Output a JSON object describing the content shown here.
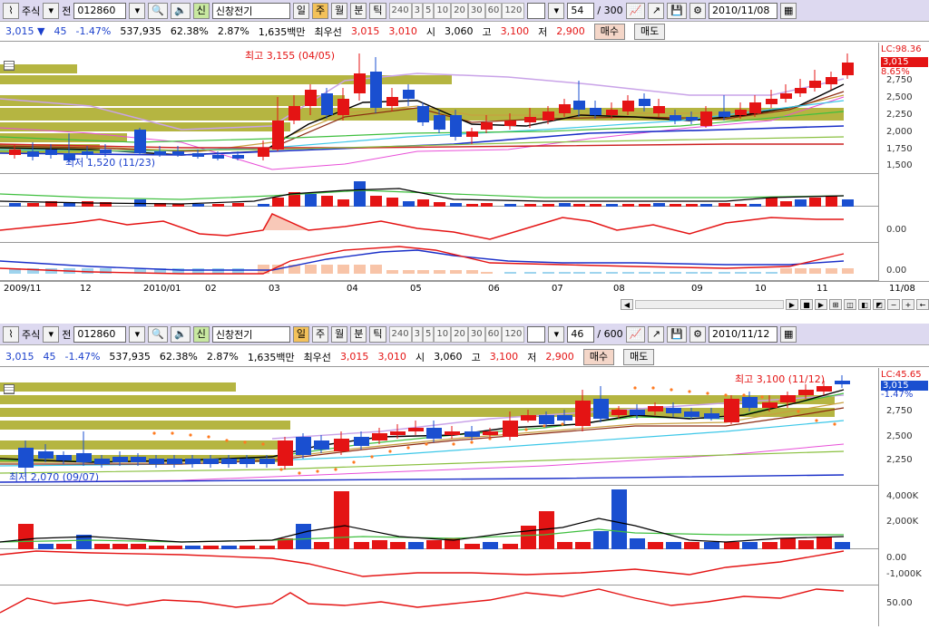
{
  "top": {
    "toolbar": {
      "market": "주식",
      "prev_label": "전",
      "code": "012860",
      "company_badge": "신",
      "company": "신창전기",
      "periods": [
        "일",
        "주",
        "월"
      ],
      "active_period": "주",
      "tick_buttons": [
        "분",
        "틱"
      ],
      "intervals": [
        "240",
        "3",
        "5",
        "10",
        "20",
        "30",
        "60",
        "120"
      ],
      "count": "54",
      "total": "/ 300",
      "date": "2010/11/08"
    },
    "annotations": {
      "high": "최고 3,155 (04/05)",
      "low": "최저 1,520 (11/23)"
    },
    "axis": {
      "lc": "LC:98.36",
      "price_tag": "3,015",
      "percent_tag": "8.65%",
      "price_ticks": [
        "2,750",
        "2,500",
        "2,250",
        "2,000",
        "1,750",
        "1,500"
      ],
      "ind1_ticks": [
        "0.00"
      ],
      "ind2_ticks": [
        "0.00"
      ]
    },
    "dates": [
      "2009/11",
      "12",
      "2010/01",
      "02",
      "03",
      "04",
      "05",
      "06",
      "07",
      "08",
      "09",
      "10",
      "11",
      "11/08"
    ]
  },
  "info": {
    "price": "3,015",
    "change": "45",
    "change_pct": "-1.47%",
    "volume": "537,935",
    "ratio1": "62.38%",
    "ratio2": "2.87%",
    "amount": "1,635백만",
    "best_label": "최우선",
    "ask": "3,015",
    "bid": "3,010",
    "open_label": "시",
    "open": "3,060",
    "high_label": "고",
    "high": "3,100",
    "low_label": "저",
    "low": "2,900",
    "buy_label": "매수",
    "sell_label": "매도"
  },
  "bottom": {
    "toolbar": {
      "market": "주식",
      "prev_label": "전",
      "code": "012860",
      "company_badge": "신",
      "company": "신창전기",
      "periods": [
        "일",
        "주",
        "월"
      ],
      "active_period": "일",
      "tick_buttons": [
        "분",
        "틱"
      ],
      "intervals": [
        "240",
        "3",
        "5",
        "10",
        "20",
        "30",
        "60",
        "120"
      ],
      "count": "46",
      "total": "/ 600",
      "date": "2010/11/12"
    },
    "annotations": {
      "high": "최고 3,100 (11/12)",
      "low": "최저 2,070 (09/07)"
    },
    "axis": {
      "lc": "LC:45.65",
      "price_tag": "3,015",
      "percent_tag": "-1.47%",
      "price_ticks": [
        "2,750",
        "2,500",
        "2,250"
      ],
      "volume_ticks": [
        "4,000K",
        "2,000K"
      ],
      "ind1_ticks": [
        "0.00",
        "-1,000K"
      ],
      "ind2_ticks": [
        "50.00"
      ]
    }
  },
  "colors": {
    "up": "#e41414",
    "down": "#1a4fd0",
    "profile": "#b5b541"
  }
}
